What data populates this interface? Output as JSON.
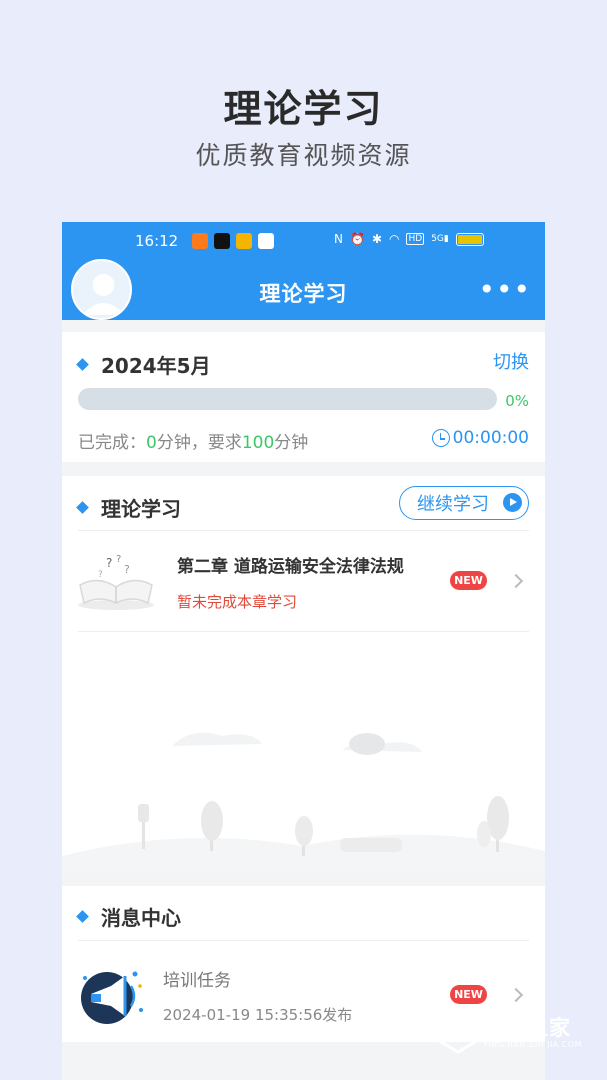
{
  "promo": {
    "title": "理论学习",
    "subtitle": "优质教育视频资源"
  },
  "status_bar": {
    "time": "16:12",
    "app_icons": [
      "taobao-icon",
      "tiktok-icon",
      "vip-icon",
      "search-app-icon"
    ],
    "system_icons": [
      "nfc-icon",
      "alarm-icon",
      "bluetooth-icon",
      "wifi-icon",
      "hd-icon",
      "signal-icon",
      "battery-icon"
    ],
    "network": "5G",
    "hd": "HD"
  },
  "header": {
    "title": "理论学习",
    "more_icon": "more-dots-icon"
  },
  "month_card": {
    "title": "2024年5月",
    "switch_label": "切换",
    "progress": 0,
    "progress_text": "0%",
    "done_prefix": "已完成：",
    "done_minutes": "0",
    "done_mid": "分钟，要求",
    "required_minutes": "100",
    "done_suffix": "分钟",
    "timer": "00:00:00",
    "colors": {
      "accent": "#2b95f1",
      "green": "#3cc86a"
    }
  },
  "study_card": {
    "title": "理论学习",
    "continue_label": "继续学习",
    "chapter": {
      "title": "第二章  道路运输安全法律法规",
      "status": "暂未完成本章学习",
      "badge": "NEW"
    }
  },
  "message_card": {
    "title": "消息中心",
    "item": {
      "title": "培训任务",
      "time": "2024-01-19 15:35:56发布",
      "badge": "NEW"
    }
  },
  "watermark": {
    "text": "硬件之家",
    "sub": "YING JIAN ZHI JIA.COM"
  }
}
